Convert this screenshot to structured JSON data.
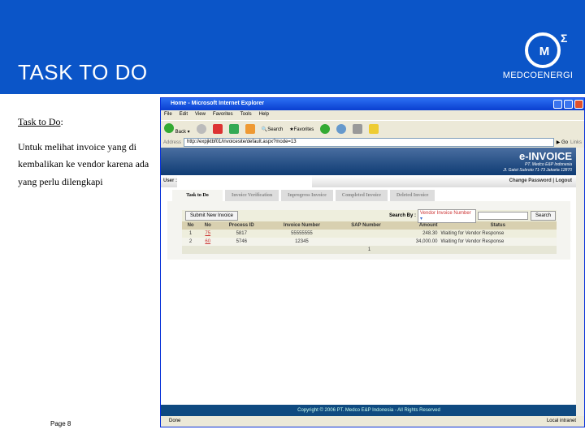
{
  "slide": {
    "title": "TASK TO DO",
    "logo_text": "MEDCOENERGI",
    "heading": "Task to Do",
    "heading_colon": ":",
    "lines": [
      "Untuk melihat invoice yang di",
      "kembalikan ke vendor karena ada",
      "yang perlu dilengkapi"
    ],
    "page": "Page 8"
  },
  "browser": {
    "title": "Home - Microsoft Internet Explorer",
    "menu": [
      "File",
      "Edit",
      "View",
      "Favorites",
      "Tools",
      "Help"
    ],
    "back": "Back",
    "search": "Search",
    "favorites": "Favorites",
    "address_label": "Address",
    "url": "http://expjktbf01/invoicesite/default.aspx?mode=13",
    "go": "Go",
    "links": "Links",
    "status": "Done",
    "zone": "Local intranet"
  },
  "app": {
    "name": "e-INVOICE",
    "company": "PT. Medco E&P Indonesia",
    "address": "Jl. Gatot Subroto 71-73 Jakarta 12870",
    "user_label": "User :",
    "change_password": "Change Password",
    "sep": "|",
    "logout": "Logout",
    "tabs": [
      "Task to Do",
      "Invoice Verification",
      "Inprogress Invoice",
      "Completed Invoice",
      "Deleted Invoice"
    ],
    "submit": "Submit New Invoice",
    "search_by": "Search By :",
    "search_option": "Vendor Invoice Number",
    "search_button": "Search",
    "columns": [
      "No",
      "No",
      "Process ID",
      "Invoice Number",
      "SAP Number",
      "Amount",
      "Status"
    ],
    "rows": [
      [
        "1",
        "75",
        "5817",
        "55555555",
        "",
        "248.30",
        "Waiting for Vendor Response"
      ],
      [
        "2",
        "60",
        "5746",
        "12345",
        "",
        "34,000.00",
        "Waiting for Vendor Response"
      ]
    ],
    "pager": "1",
    "footer": "Copyright © 2006 PT. Medco E&P Indonesia - All Rights Reserved"
  }
}
